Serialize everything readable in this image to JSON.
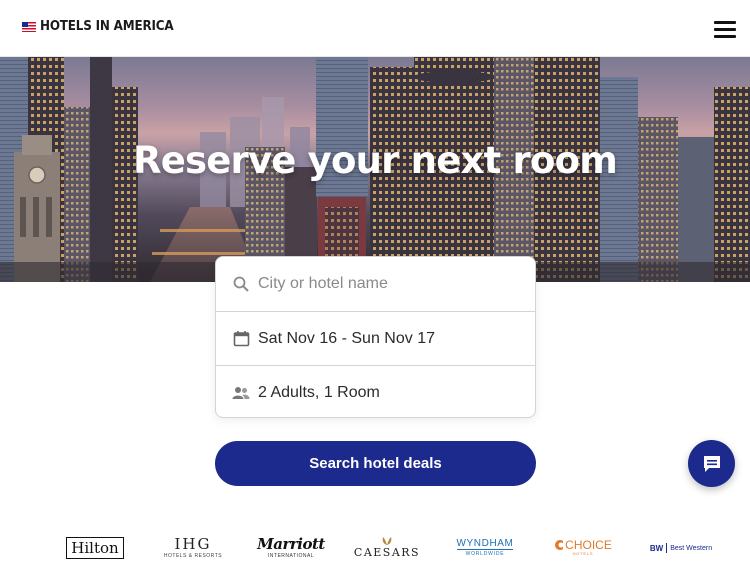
{
  "header": {
    "logo_text": "HOTELS IN AMERICA",
    "menu_icon": "hamburger-menu-icon"
  },
  "hero": {
    "title": "Reserve your next room"
  },
  "search": {
    "destination_placeholder": "City or hotel name",
    "dates_value": "Sat Nov 16 - Sun Nov 17",
    "guests_value": "2 Adults, 1 Room",
    "button_label": "Search hotel deals",
    "icons": [
      "search-icon",
      "calendar-icon",
      "guests-icon"
    ]
  },
  "chat": {
    "icon": "chat-icon"
  },
  "brands": {
    "hilton": "Hilton",
    "ihg_main": "IHG",
    "ihg_sub": "HOTELS & RESORTS",
    "marriott_main": "Marriott",
    "marriott_sub": "INTERNATIONAL",
    "caesars": "CAESARS",
    "wyndham_main": "WYNDHAM",
    "wyndham_sub": "WORLDWIDE",
    "choice_main": "CHOICE",
    "choice_sub": "HOTELS",
    "bw_mark": "BW",
    "bw_name": "Best Western"
  },
  "colors": {
    "primary": "#1b2a8c",
    "text": "#2b2b2b",
    "placeholder": "#8a8a8a",
    "choice_orange": "#e07a2c",
    "wyndham_blue": "#1f6fb2"
  }
}
